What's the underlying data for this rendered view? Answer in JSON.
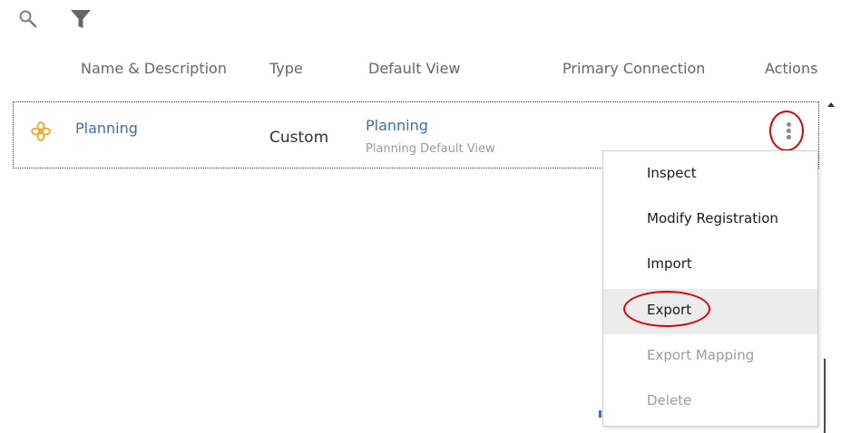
{
  "toolbar": {
    "search_icon": "search-icon",
    "filter_icon": "filter-icon"
  },
  "table": {
    "columns": [
      "Name & Description",
      "Type",
      "Default View",
      "Primary Connection",
      "Actions"
    ],
    "rows": [
      {
        "icon": "flower-icon",
        "name": "Planning",
        "type": "Custom",
        "default_view": "Planning",
        "default_view_description": "Planning Default View",
        "primary_connection": ""
      }
    ]
  },
  "actions_menu": {
    "items": [
      {
        "label": "Inspect",
        "enabled": true
      },
      {
        "label": "Modify Registration",
        "enabled": true
      },
      {
        "label": "Import",
        "enabled": true
      },
      {
        "label": "Export",
        "enabled": true,
        "hovered": true
      },
      {
        "label": "Export Mapping",
        "enabled": false
      },
      {
        "label": "Delete",
        "enabled": false
      }
    ]
  },
  "colors": {
    "link": "#3a6fb0",
    "accent_icon": "#f5a623",
    "callout": "#e00000",
    "hover_bg": "#ececec",
    "disabled_text": "#9c9c9c"
  }
}
